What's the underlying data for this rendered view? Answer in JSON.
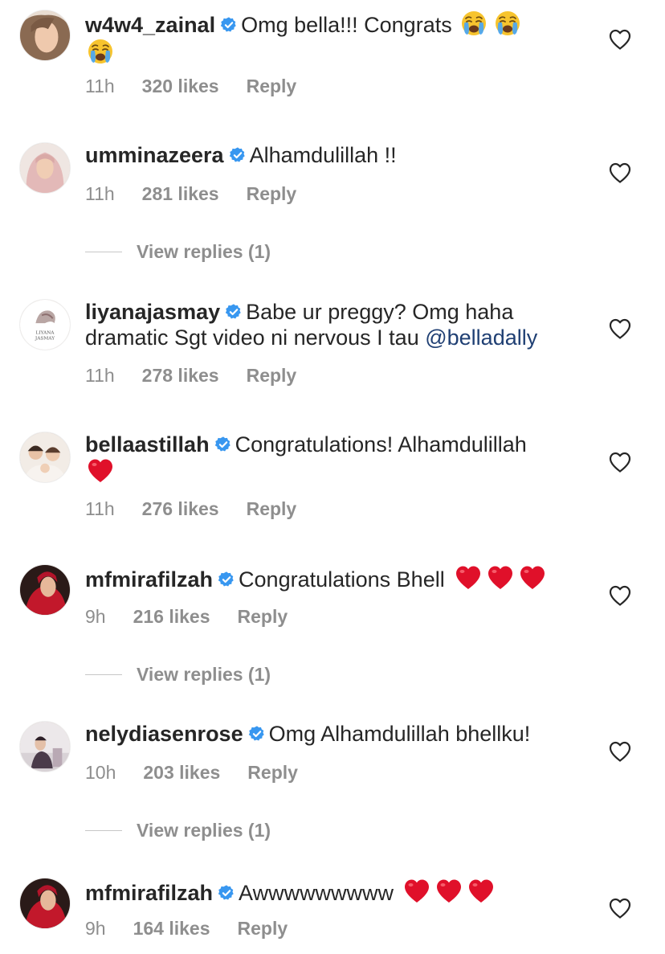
{
  "comments": [
    {
      "username": "w4w4_zainal",
      "text": "Omg bella!!! Congrats",
      "emoji": [
        "crying-face",
        "crying-face",
        "crying-face"
      ],
      "time": "11h",
      "likes": "320 likes",
      "reply": "Reply"
    },
    {
      "username": "umminazeera",
      "text": "Alhamdulillah !!",
      "time": "11h",
      "likes": "281 likes",
      "reply": "Reply",
      "view_replies": "View replies (1)"
    },
    {
      "username": "liyanajasmay",
      "text_line1": "Babe ur preggy? Omg haha",
      "text_line2": "dramatic Sgt video ni nervous I tau",
      "mention": "@belladally",
      "avatar_text": "LIYANA JASMAY",
      "time": "11h",
      "likes": "278 likes",
      "reply": "Reply"
    },
    {
      "username": "bellaastillah",
      "text": "Congratulations! Alhamdulillah",
      "emoji": [
        "red-heart"
      ],
      "time": "11h",
      "likes": "276 likes",
      "reply": "Reply"
    },
    {
      "username": "mfmirafilzah",
      "text": "Congratulations Bhell",
      "emoji": [
        "red-heart",
        "red-heart",
        "red-heart"
      ],
      "time": "9h",
      "likes": "216 likes",
      "reply": "Reply",
      "view_replies": "View replies (1)"
    },
    {
      "username": "nelydiasenrose",
      "text": "Omg Alhamdulillah bhellku!",
      "time": "10h",
      "likes": "203 likes",
      "reply": "Reply",
      "view_replies": "View replies (1)"
    },
    {
      "username": "mfmirafilzah",
      "text": "Awwwwwwwww",
      "emoji": [
        "red-heart",
        "red-heart",
        "red-heart"
      ],
      "time": "9h",
      "likes": "164 likes",
      "reply": "Reply"
    }
  ],
  "icons": {
    "verified": "verified-badge-icon",
    "like": "heart-outline-icon"
  },
  "colors": {
    "verified_blue": "#3897f0",
    "meta_gray": "#8e8e8e",
    "mention_blue": "#1f3f73",
    "heart_red": "#e0102a"
  }
}
